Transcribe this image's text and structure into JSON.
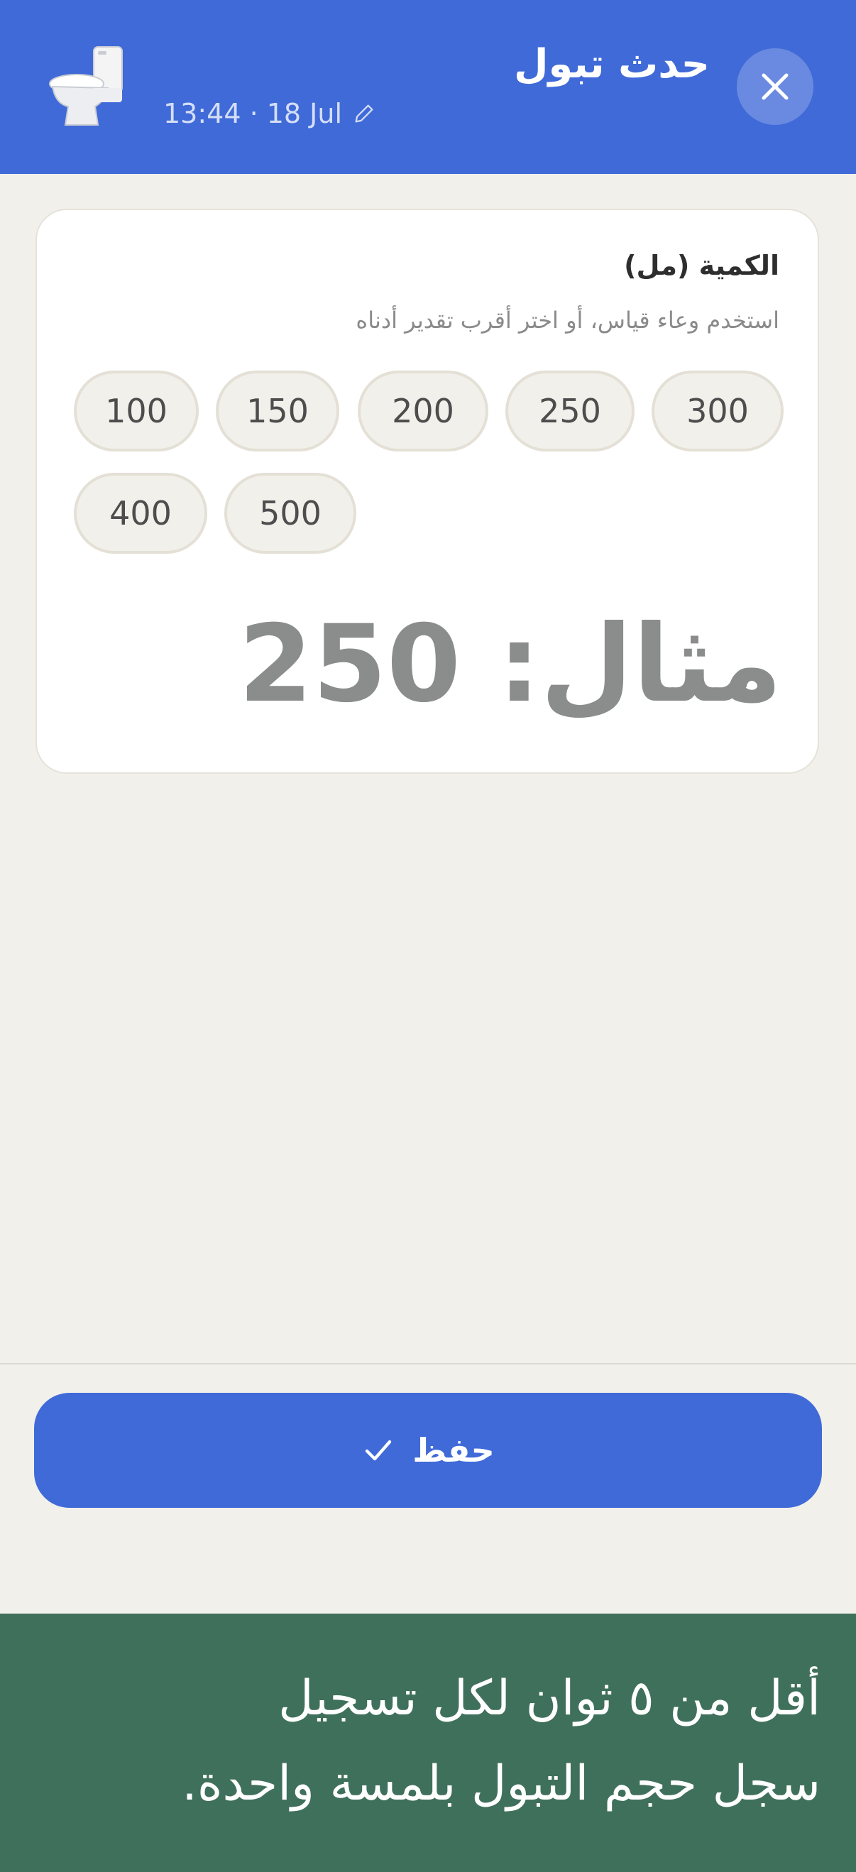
{
  "header": {
    "title": "حدث تبول",
    "datetime": "13:44 · 18 Jul"
  },
  "amount": {
    "label": "الكمية (مل)",
    "hint": "استخدم وعاء قياس، أو اختر أقرب تقدير أدناه",
    "chips": [
      "300",
      "250",
      "200",
      "150",
      "100",
      "500",
      "400"
    ],
    "placeholder": "مثال: 250"
  },
  "actions": {
    "save_label": "حفظ"
  },
  "banner": {
    "line1": "أقل من ٥ ثوان لكل تسجيل",
    "line2": "سجل حجم التبول بلمسة واحدة."
  },
  "colors": {
    "primary": "#3F6AD8",
    "background": "#F2F0EB",
    "banner": "#3F705B"
  }
}
